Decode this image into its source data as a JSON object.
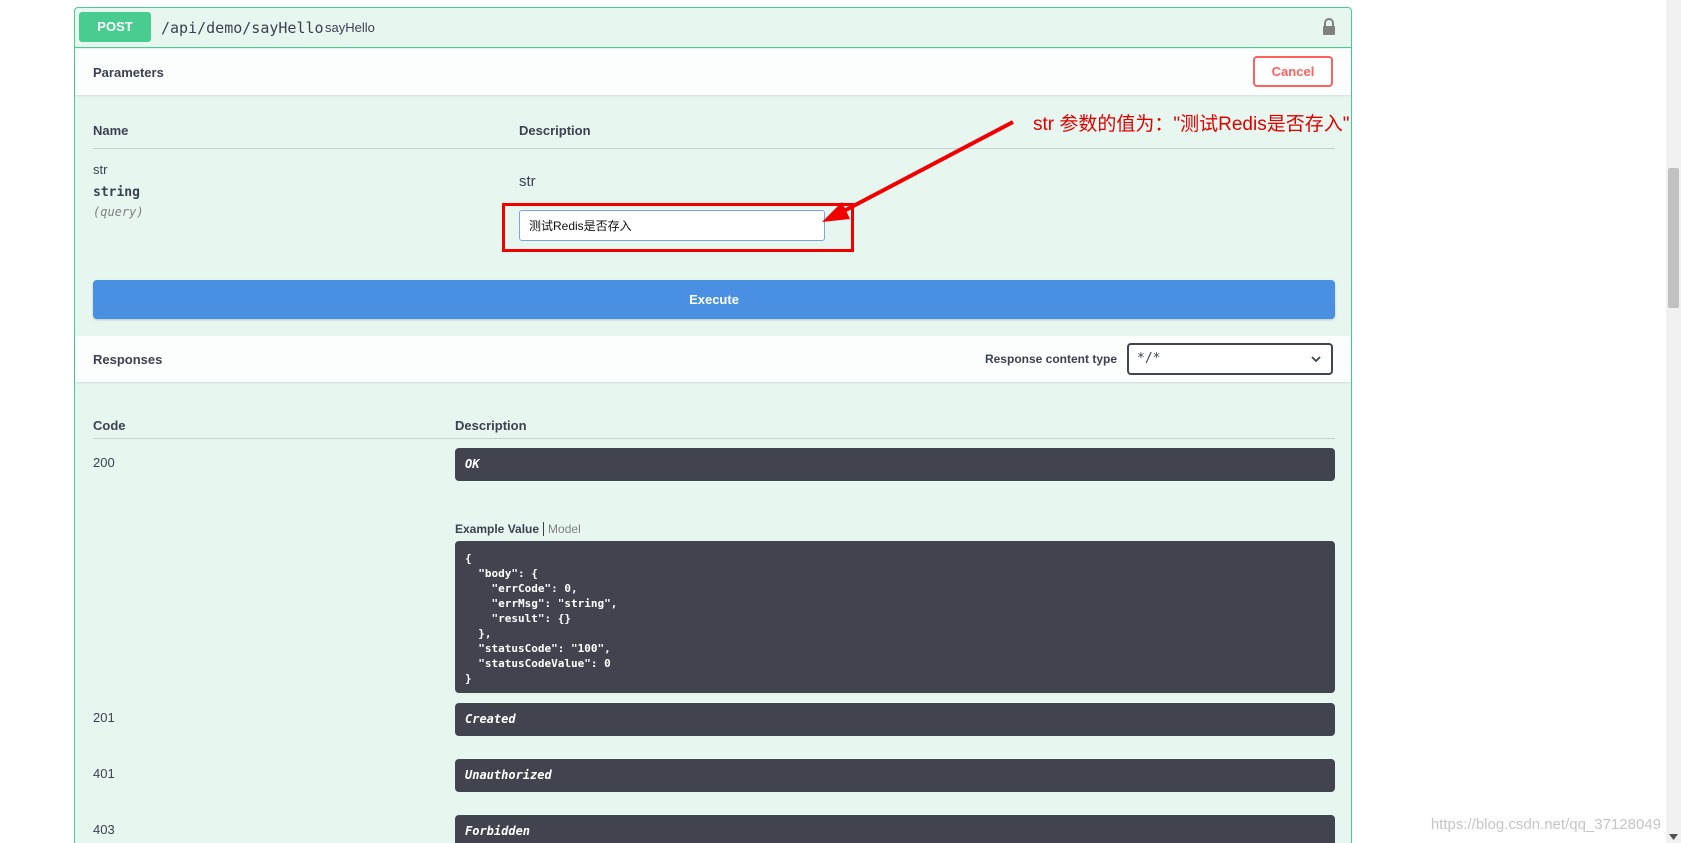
{
  "operation": {
    "method": "POST",
    "path": "/api/demo/sayHello",
    "operation_id": "sayHello"
  },
  "parameters": {
    "title": "Parameters",
    "cancel_label": "Cancel",
    "col_name": "Name",
    "col_description": "Description",
    "items": [
      {
        "name": "str",
        "type": "string",
        "in": "(query)",
        "description": "str",
        "value": "测试Redis是否存入"
      }
    ],
    "execute_label": "Execute"
  },
  "responses": {
    "title": "Responses",
    "content_type_label": "Response content type",
    "content_type_value": "*/*",
    "col_code": "Code",
    "col_description": "Description",
    "items": [
      {
        "code": "200",
        "description": "OK"
      },
      {
        "code": "201",
        "description": "Created"
      },
      {
        "code": "401",
        "description": "Unauthorized"
      },
      {
        "code": "403",
        "description": "Forbidden"
      }
    ],
    "example_tab_active": "Example Value",
    "example_tab_inactive": "Model",
    "example_value": "{\n  \"body\": {\n    \"errCode\": 0,\n    \"errMsg\": \"string\",\n    \"result\": {}\n  },\n  \"statusCode\": \"100\",\n  \"statusCodeValue\": 0\n}"
  },
  "annotation": {
    "text": "str 参数的值为：\"测试Redis是否存入\"",
    "color": "#e00000"
  },
  "watermark": "https://blog.csdn.net/qq_37128049",
  "colors": {
    "post_green": "#49cc90",
    "execute_blue": "#4990e2",
    "cancel_red": "#ff6060",
    "dark_block": "#41444e"
  }
}
